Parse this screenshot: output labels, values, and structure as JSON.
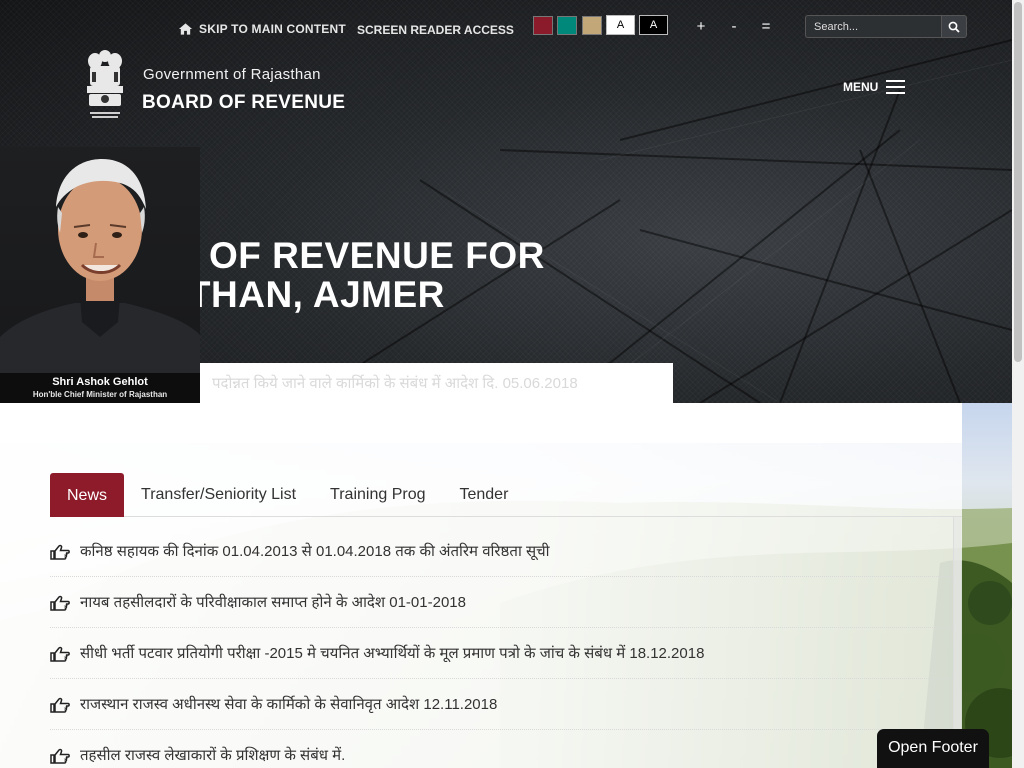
{
  "utility_bar": {
    "skip_link": "SKIP TO MAIN CONTENT",
    "screen_reader": "SCREEN READER ACCESS",
    "theme_colors": [
      "#8b1a2b",
      "#00897b",
      "#c2a878"
    ],
    "contrast_white_label": "A",
    "contrast_black_label": "A",
    "font_increase": "+",
    "font_decrease": "-",
    "font_reset": "=",
    "search_placeholder": "Search..."
  },
  "header": {
    "gov_title": "Government of Rajasthan",
    "site_title": "BOARD OF REVENUE",
    "menu_label": "MENU"
  },
  "hero": {
    "title_line1": "BOARD OF REVENUE FOR",
    "title_line2": "RAJASTHAN, AJMER"
  },
  "cm": {
    "name": "Shri Ashok Gehlot",
    "role": "Hon'ble Chief Minister of Rajasthan"
  },
  "ticker": {
    "text": "पदोन्नत किये जाने वाले कार्मिको के संबंध में आदेश दि. 05.06.2018"
  },
  "tabs": [
    {
      "label": "News",
      "active": true
    },
    {
      "label": "Transfer/Seniority List",
      "active": false
    },
    {
      "label": "Training Prog",
      "active": false
    },
    {
      "label": "Tender",
      "active": false
    }
  ],
  "news": [
    "कनिष्ठ सहायक की दिनांक 01.04.2013 से 01.04.2018 तक की अंतरिम वरिष्ठता सूची",
    "नायब तहसीलदारों के परिवीक्षाकाल समाप्त होने के आदेश 01-01-2018",
    "सीधी भर्ती पटवार प्रतियोगी परीक्षा -2015 मे चयनित अभ्यार्थियों के मूल प्रमाण पत्रो के जांच के संबंध में 18.12.2018",
    "राजस्थान राजस्व अधीनस्थ सेवा के कार्मिको के सेवानिवृत आदेश 12.11.2018",
    "तहसील राजस्व लेखाकारों के प्रशिक्षण के संबंध में."
  ],
  "footer": {
    "open_label": "Open Footer"
  },
  "colors": {
    "accent": "#8e1b2a",
    "header_bg": "#1b1d1f"
  }
}
